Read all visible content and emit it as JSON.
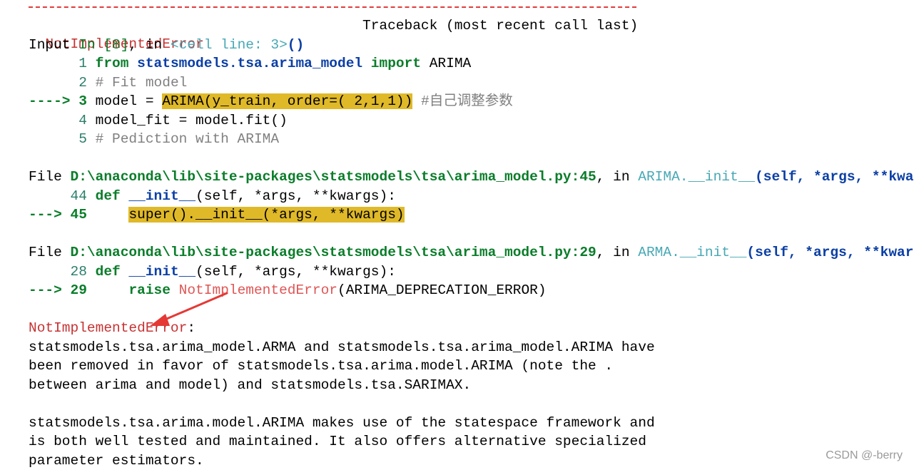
{
  "traceback": {
    "error_name": "NotImplementedError",
    "header_right": "Traceback (most recent call last)",
    "input_line": {
      "prefix": "Input ",
      "in_label": "In [8]",
      "sep": ", in ",
      "location": "<cell line: 3>",
      "parens": "()"
    },
    "cell_lines": [
      {
        "no": "1",
        "pre": " ",
        "text_kw": "from",
        "text_mod": "statsmodels.tsa.arima_model",
        "text_kw2": "import",
        "text_rest": " ARIMA"
      },
      {
        "no": "2",
        "text": " # Fit model"
      },
      {
        "arrow": "---->",
        "no": "3",
        "pre": " model = ",
        "hl": "ARIMA(y_train, order=( 2,1,1))",
        "comment": " #自己调整参数"
      },
      {
        "no": "4",
        "text": " model_fit = model.fit()"
      },
      {
        "no": "5",
        "text": " # Pediction with ARIMA"
      }
    ],
    "frame1": {
      "file_label": "File ",
      "path": "D:\\anaconda\\lib\\site-packages\\statsmodels\\tsa\\arima_model.py:45",
      "in_sep": ", in ",
      "func": "ARIMA.__init__",
      "args": "(self, *args, **kwargs)",
      "line_a_no": "44",
      "line_a": {
        "kw": "def",
        "name": " __init__",
        "rest": "(self, *args, **kwargs):"
      },
      "arrow": "--->",
      "line_b_no": "45",
      "line_b_hl": "super().__init__(*args, **kwargs)"
    },
    "frame2": {
      "file_label": "File ",
      "path": "D:\\anaconda\\lib\\site-packages\\statsmodels\\tsa\\arima_model.py:29",
      "in_sep": ", in ",
      "func": "ARMA.__init__",
      "args": "(self, *args, **kwargs)",
      "line_a_no": "28",
      "line_a": {
        "kw": "def",
        "name": " __init__",
        "rest": "(self, *args, **kwargs):"
      },
      "arrow": "--->",
      "line_b_no": "29",
      "line_b": {
        "kw": "raise",
        "err": "NotImplementedError",
        "rest": "(ARIMA_DEPRECATION_ERROR)"
      }
    },
    "final_error": "NotImplementedError",
    "final_colon": ":",
    "message_lines": [
      "statsmodels.tsa.arima_model.ARMA and statsmodels.tsa.arima_model.ARIMA have",
      "been removed in favor of statsmodels.tsa.arima.model.ARIMA (note the .",
      "between arima and model) and statsmodels.tsa.SARIMAX.",
      "",
      "statsmodels.tsa.arima.model.ARIMA makes use of the statespace framework and",
      "is both well tested and maintained. It also offers alternative specialized",
      "parameter estimators."
    ]
  },
  "watermark": "CSDN @-berry",
  "colors": {
    "error_red": "#c73232",
    "highlight": "#e0b929",
    "annotation_arrow": "#e53935"
  }
}
